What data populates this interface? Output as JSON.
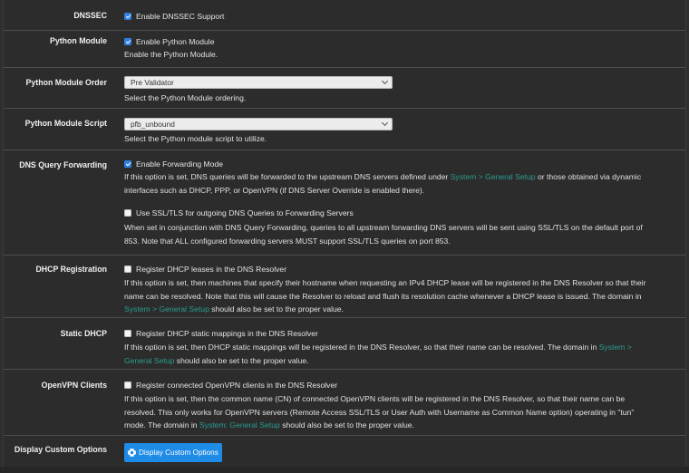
{
  "rows": {
    "dnssec": {
      "label": "DNSSEC",
      "checkbox_label": "Enable DNSSEC Support"
    },
    "python_module": {
      "label": "Python Module",
      "checkbox_label": "Enable Python Module",
      "help": "Enable the Python Module."
    },
    "python_module_order": {
      "label": "Python Module Order",
      "selected": "Pre Validator",
      "help": "Select the Python Module ordering."
    },
    "python_module_script": {
      "label": "Python Module Script",
      "selected": "pfb_unbound",
      "help": "Select the Python module script to utilize."
    },
    "dns_query_forwarding": {
      "label": "DNS Query Forwarding",
      "checkbox_label": "Enable Forwarding Mode",
      "help_1a": "If this option is set, DNS queries will be forwarded to the upstream DNS servers defined under ",
      "help_1_link": "System > General Setup",
      "help_1b": " or those obtained via dynamic",
      "help_2": "interfaces such as DHCP, PPP, or OpenVPN (if DNS Server Override is enabled there).",
      "ssl_checkbox_label": "Use SSL/TLS for outgoing DNS Queries to Forwarding Servers",
      "ssl_help_1": "When set in conjunction with DNS Query Forwarding, queries to all upstream forwarding DNS servers will be sent using SSL/TLS on the default port of",
      "ssl_help_2": "853. Note that ALL configured forwarding servers MUST support SSL/TLS queries on port 853."
    },
    "dhcp_registration": {
      "label": "DHCP Registration",
      "checkbox_label": "Register DHCP leases in the DNS Resolver",
      "help_1": "If this option is set, then machines that specify their hostname when requesting an IPv4 DHCP lease will be registered in the DNS Resolver so that their",
      "help_2": "name can be resolved. Note that this will cause the Resolver to reload and flush its resolution cache whenever a DHCP lease is issued. The domain in",
      "help_3_link": "System > General Setup",
      "help_3b": " should also be set to the proper value."
    },
    "static_dhcp": {
      "label": "Static DHCP",
      "checkbox_label": "Register DHCP static mappings in the DNS Resolver",
      "help_1a": "If this option is set, then DHCP static mappings will be registered in the DNS Resolver, so that their name can be resolved. The domain in ",
      "help_1_link": "System >",
      "help_2_link": "General Setup",
      "help_2b": " should also be set to the proper value."
    },
    "openvpn_clients": {
      "label": "OpenVPN Clients",
      "checkbox_label": "Register connected OpenVPN clients in the DNS Resolver",
      "help_1": "If this option is set, then the common name (CN) of connected OpenVPN clients will be registered in the DNS Resolver, so that their name can be",
      "help_2": "resolved. This only works for OpenVPN servers (Remote Access SSL/TLS or User Auth with Username as Common Name option) operating in \"tun\"",
      "help_3a": "mode. The domain in ",
      "help_3_link": "System: General Setup",
      "help_3b": " should also be set to the proper value."
    },
    "display_custom_options": {
      "label": "Display Custom Options",
      "button_label": "Display Custom Options",
      "button_icon": "gear-icon"
    }
  },
  "colors": {
    "accent": "#1e8be6",
    "link": "#2a9d8f",
    "background": "#2c2c2c"
  }
}
